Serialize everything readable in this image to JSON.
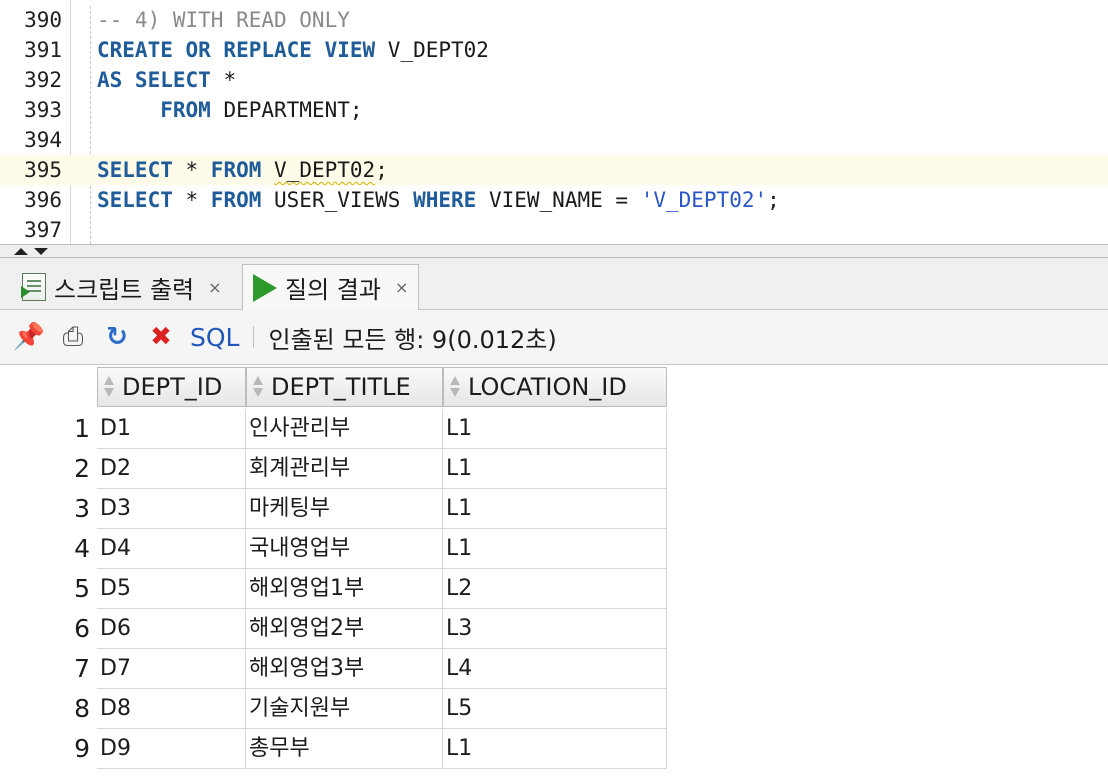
{
  "editor": {
    "lines": [
      {
        "num": "390",
        "html": "<span class=\"cm\">-- 4) WITH READ ONLY</span>"
      },
      {
        "num": "391",
        "html": "<span class=\"kw\">CREATE OR REPLACE VIEW</span> V_DEPT02"
      },
      {
        "num": "392",
        "html": "<span class=\"kw\">AS SELECT</span> *"
      },
      {
        "num": "393",
        "html": "     <span class=\"kw\">FROM</span> DEPARTMENT;"
      },
      {
        "num": "394",
        "html": ""
      },
      {
        "num": "395",
        "html": "<span class=\"kw\">SELECT</span> * <span class=\"kw\">FROM</span> <span class=\"squig\">V_DEPT02</span>;"
      },
      {
        "num": "396",
        "html": "<span class=\"kw\">SELECT</span> * <span class=\"kw\">FROM</span> USER_VIEWS <span class=\"kw\">WHERE</span> VIEW_NAME = <span class=\"str\">'V_DEPT02'</span>;"
      },
      {
        "num": "397",
        "html": ""
      }
    ],
    "current_line": "395"
  },
  "tabs": [
    {
      "label": "스크립트 출력",
      "close": "×",
      "icon": "script-output-icon"
    },
    {
      "label": "질의 결과",
      "close": "×",
      "icon": "play-icon"
    }
  ],
  "toolbar": {
    "sql_label": "SQL",
    "status": "인출된 모든 행: 9(0.012초)"
  },
  "grid": {
    "columns": [
      "DEPT_ID",
      "DEPT_TITLE",
      "LOCATION_ID"
    ],
    "rows": [
      {
        "n": "1",
        "cells": [
          "D1",
          "인사관리부",
          "L1"
        ]
      },
      {
        "n": "2",
        "cells": [
          "D2",
          "회계관리부",
          "L1"
        ]
      },
      {
        "n": "3",
        "cells": [
          "D3",
          "마케팅부",
          "L1"
        ]
      },
      {
        "n": "4",
        "cells": [
          "D4",
          "국내영업부",
          "L1"
        ]
      },
      {
        "n": "5",
        "cells": [
          "D5",
          "해외영업1부",
          "L2"
        ]
      },
      {
        "n": "6",
        "cells": [
          "D6",
          "해외영업2부",
          "L3"
        ]
      },
      {
        "n": "7",
        "cells": [
          "D7",
          "해외영업3부",
          "L4"
        ]
      },
      {
        "n": "8",
        "cells": [
          "D8",
          "기술지원부",
          "L5"
        ]
      },
      {
        "n": "9",
        "cells": [
          "D9",
          "총무부",
          "L1"
        ]
      }
    ]
  },
  "colors": {
    "keyword": "#1f5c99",
    "comment": "#8a8a8a",
    "string": "#2a55c8",
    "current_line": "#fefbe8"
  }
}
